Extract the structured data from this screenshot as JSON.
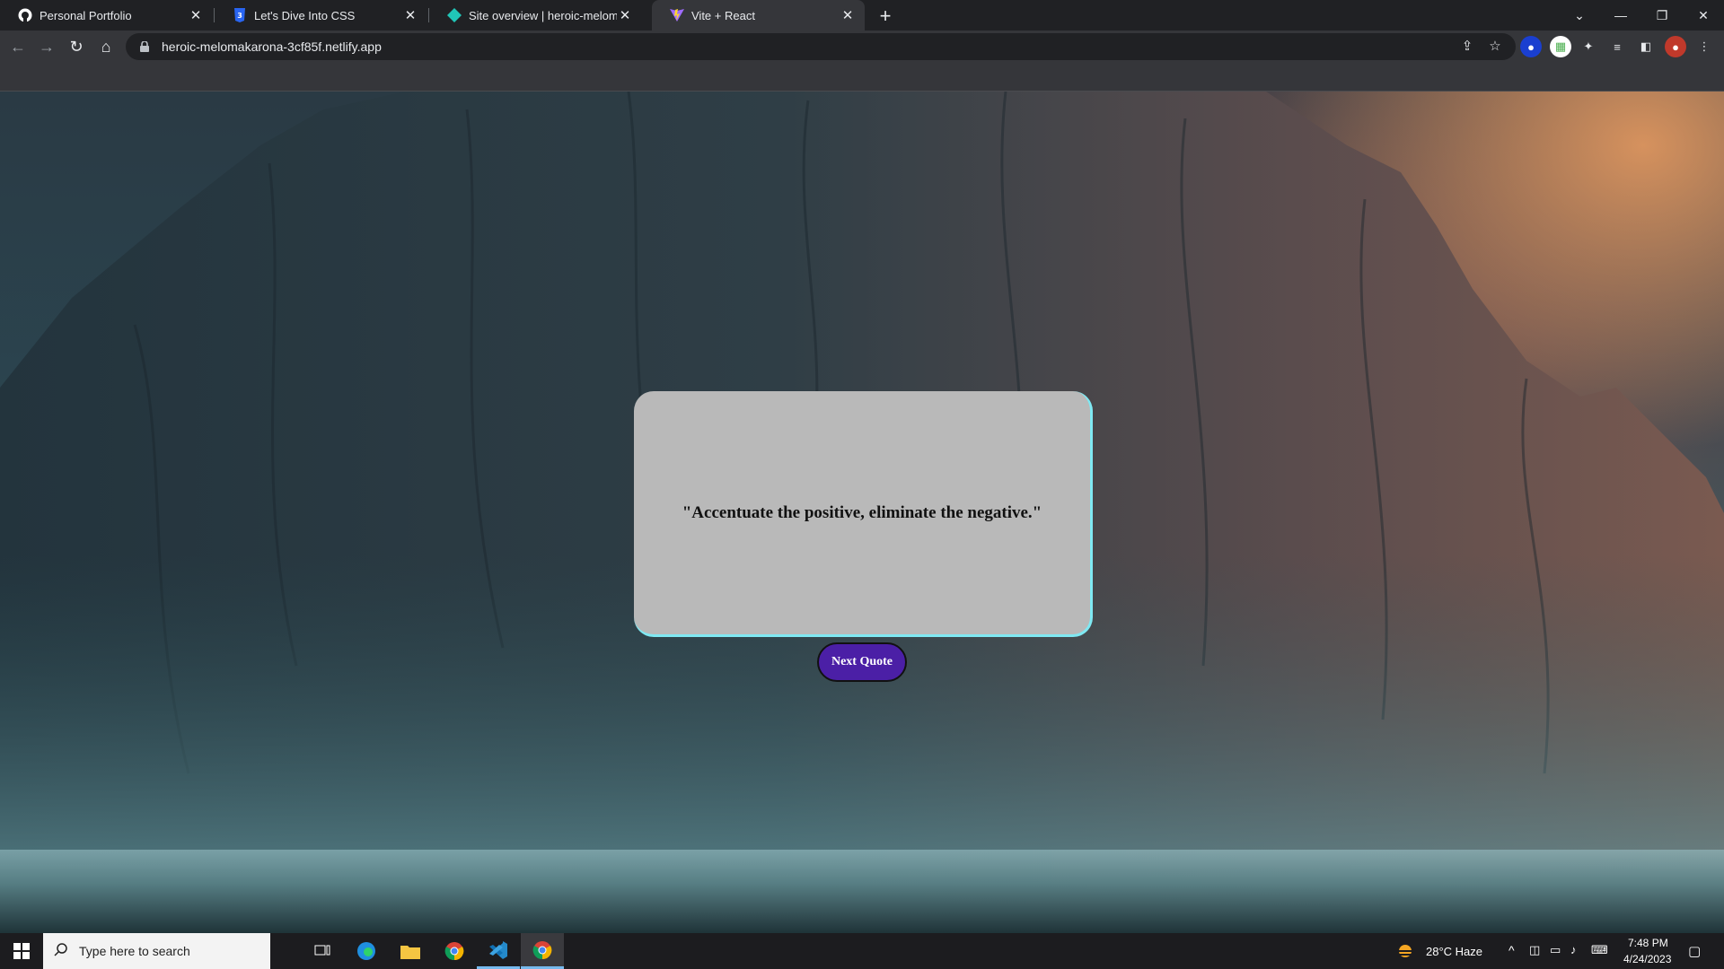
{
  "browser": {
    "tabs": [
      {
        "title": "Personal Portfolio",
        "favicon": "github-icon",
        "active": false
      },
      {
        "title": "Let's Dive Into CSS",
        "favicon": "css3-icon",
        "active": false
      },
      {
        "title": "Site overview | heroic-melomakarona",
        "favicon": "netlify-icon",
        "active": false
      },
      {
        "title": "Vite + React",
        "favicon": "vite-icon",
        "active": true
      }
    ],
    "url": "heroic-melomakarona-3cf85f.netlify.app"
  },
  "page": {
    "quote": "\"Accentuate the positive, eliminate the negative.\"",
    "next_button_label": "Next Quote",
    "colors": {
      "card": "#b9b9b9",
      "card_border": "#7fe9f3",
      "button": "#4b1fa6"
    }
  },
  "taskbar": {
    "search_placeholder": "Type here to search",
    "weather": "28°C  Haze",
    "time": "7:48 PM",
    "date": "4/24/2023"
  }
}
